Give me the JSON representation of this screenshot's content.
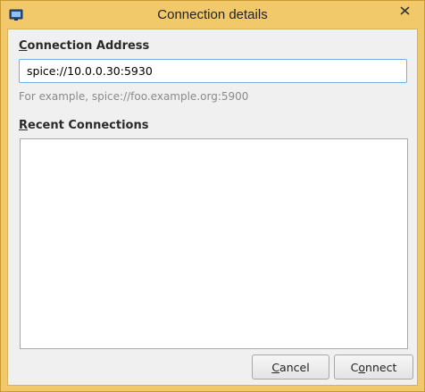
{
  "window": {
    "title": "Connection details"
  },
  "address": {
    "label_mnemonic": "C",
    "label_rest": "onnection Address",
    "value": "spice://10.0.0.30:5930",
    "hint": "For example, spice://foo.example.org:5900"
  },
  "recent": {
    "label_mnemonic": "R",
    "label_rest": "ecent Connections",
    "items": []
  },
  "buttons": {
    "cancel_mnemonic": "C",
    "cancel_rest": "ancel",
    "connect_pre": "C",
    "connect_mnemonic": "o",
    "connect_rest": "nnect"
  },
  "colors": {
    "frame": "#f1c86a",
    "input_focus_border": "#6fb1e6",
    "client_bg": "#f0f0f0"
  },
  "icons": {
    "app": "monitor-icon",
    "close": "close-icon"
  }
}
